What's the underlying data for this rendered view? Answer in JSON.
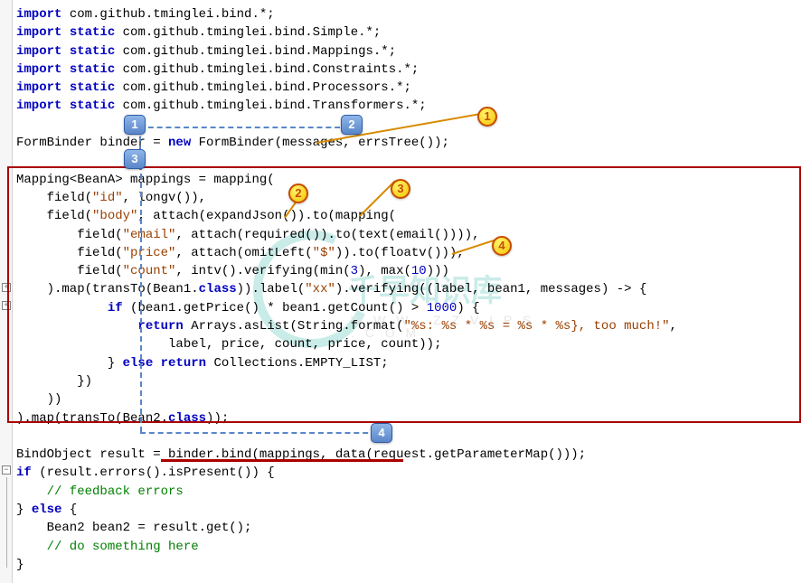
{
  "code": {
    "l1": {
      "kw1": "import",
      "rest": " com.github.tminglei.bind.*;"
    },
    "l2": {
      "kw1": "import",
      "kw2": "static",
      "rest": " com.github.tminglei.bind.Simple.*;"
    },
    "l3": {
      "kw1": "import",
      "kw2": "static",
      "rest": " com.github.tminglei.bind.Mappings.*;"
    },
    "l4": {
      "kw1": "import",
      "kw2": "static",
      "rest": " com.github.tminglei.bind.Constraints.*;"
    },
    "l5": {
      "kw1": "import",
      "kw2": "static",
      "rest": " com.github.tminglei.bind.Processors.*;"
    },
    "l6": {
      "kw1": "import",
      "kw2": "static",
      "rest": " com.github.tminglei.bind.Transformers.*;"
    },
    "l8a": "FormBinder binder = ",
    "l8kw": "new",
    "l8b": " FormBinder(messages, errsTree());",
    "l10": "Mapping<BeanA> mappings = mapping(",
    "l11a": "    field(",
    "l11s": "\"id\"",
    "l11b": ", longv()),",
    "l12a": "    field(",
    "l12s": "\"body\"",
    "l12b": ", attach(expandJson()).to(mapping(",
    "l13a": "        field(",
    "l13s": "\"email\"",
    "l13b": ", attach(required()).to(text(email()))),",
    "l14a": "        field(",
    "l14s": "\"price\"",
    "l14b": ", attach(omitLeft(",
    "l14s2": "\"$\"",
    "l14c": ")).to(floatv())),",
    "l15a": "        field(",
    "l15s": "\"count\"",
    "l15b": ", intv().verifying(min(",
    "l15n1": "3",
    "l15c": "), max(",
    "l15n2": "10",
    "l15d": ")))",
    "l16a": "    ).map(transTo(Bean1.",
    "l16kw": "class",
    "l16b": ")).label(",
    "l16s": "\"xx\"",
    "l16c": ").verifying((label, bean1, messages) -> {",
    "l17a": "            ",
    "l17kw": "if",
    "l17b": " (bean1.getPrice() * bean1.getCount() > ",
    "l17n": "1000",
    "l17c": ") {",
    "l18a": "                ",
    "l18kw": "return",
    "l18b": " Arrays.asList(String.format(",
    "l18s": "\"%s: %s * %s = %s * %s}, too much!\"",
    "l18c": ",",
    "l19": "                    label, price, count, price, count));",
    "l20a": "            } ",
    "l20kw1": "else",
    "l20kw2": "return",
    "l20b": " Collections.EMPTY_LIST;",
    "l21": "        })",
    "l22": "    ))",
    "l23a": ").map(transTo(Bean2.",
    "l23kw": "class",
    "l23b": "));",
    "l25": "BindObject result = binder.bind(mappings, data(request.getParameterMap()));",
    "l26a": "",
    "l26kw": "if",
    "l26b": " (result.errors().isPresent()) {",
    "l27": "    // feedback errors",
    "l28a": "} ",
    "l28kw": "else",
    "l28b": " {",
    "l29": "    Bean2 bean2 = result.get();",
    "l30": "    // do something here",
    "l31": "}"
  },
  "labels": {
    "blue1": "1",
    "blue2": "2",
    "blue3": "3",
    "blue4": "4",
    "yellow1": "1",
    "yellow2": "2",
    "yellow3": "3",
    "yellow4": "4",
    "fold_plus": "+",
    "fold_minus": "−"
  },
  "watermark": {
    "cn": "千早知识库",
    "en": "W W W . Z Z V I P S . C O M"
  }
}
